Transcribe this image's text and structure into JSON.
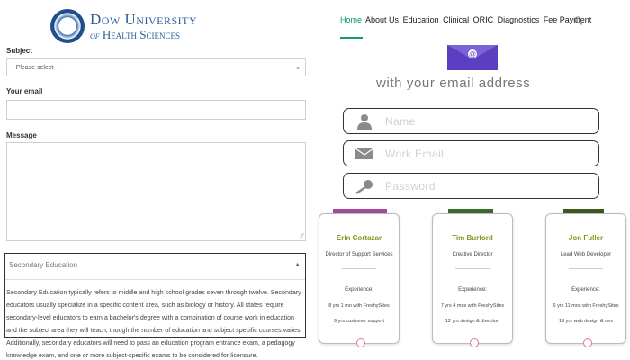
{
  "brand": {
    "line1": "Dow University",
    "line2_of": "of",
    "line2": "Health Sciences"
  },
  "form": {
    "subject_label": "Subject",
    "subject_value": "--Please select--",
    "email_label": "Your email",
    "message_label": "Message"
  },
  "accordion": {
    "title": "Secondary Education",
    "body": "Secondary Education typically refers to middle and high school grades seven through twelve. Secondary educators usually specialize in a specific content area, such as biology or history. All states require secondary-level educators to earn a bachelor's degree with a combination of course work in education and the subject area they will teach, though the number of education and subject specific courses varies. Additionally, secondary educators will need to pass an education program entrance exam, a pedagogy knowledge exam, and one or more subject-specific exams to be considered for licensure."
  },
  "nav": {
    "items": [
      "Home",
      "About Us",
      "Education",
      "Clinical",
      "ORIC",
      "Diagnostics",
      "Fee Payment"
    ]
  },
  "signup": {
    "heading": "with your email address",
    "name_placeholder": "Name",
    "email_placeholder": "Work Email",
    "password_placeholder": "Password"
  },
  "team": [
    {
      "name": "Erin Cortazar",
      "role": "Director of Support Services",
      "exp_label": "Experience:",
      "line1": "8 yrs 1 mo with FreshySites",
      "line2": "9 yrs customer support"
    },
    {
      "name": "Tim Burford",
      "role": "Creative Director",
      "exp_label": "Experience:",
      "line1": "7 yrs 4 mos with FreshySites",
      "line2": "12 yrs design & direction"
    },
    {
      "name": "Jon Fuller",
      "role": "Lead Web Developer",
      "exp_label": "Experience:",
      "line1": "6 yrs 11 mos with FreshySites",
      "line2": "19 yrs web design & dev"
    }
  ],
  "colors": {
    "accent": "#0e9a7a",
    "brand": "#2d5e9c",
    "name_green": "#7a9a1e",
    "envelope": "#5a3fc0"
  },
  "icons": [
    "university-seal-icon",
    "search-icon",
    "envelope-icon",
    "user-icon",
    "mail-icon",
    "key-icon",
    "chevron-down-icon",
    "chevron-up-icon"
  ]
}
